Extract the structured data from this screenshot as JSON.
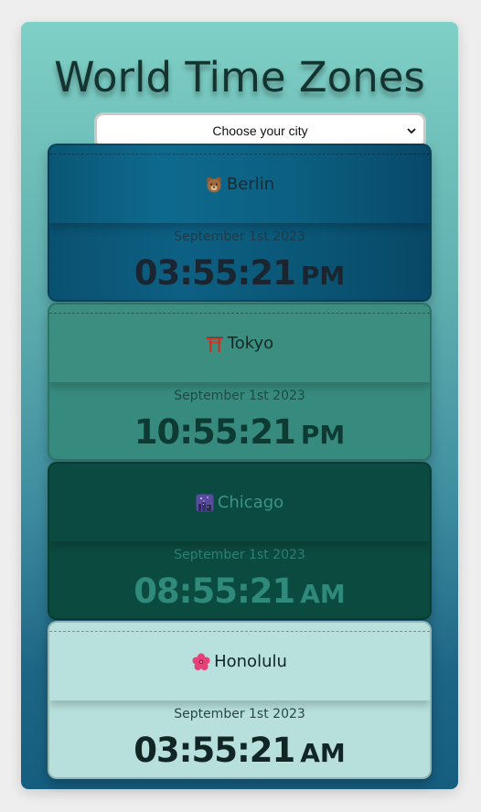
{
  "app": {
    "title": "World Time Zones",
    "select": {
      "value": "Choose your city"
    }
  },
  "cards": [
    {
      "emoji_icon": "bear-icon",
      "city": "Berlin",
      "date": "September 1st 2023",
      "time": "03:55:21",
      "ampm": "PM"
    },
    {
      "emoji_icon": "torii-gate-icon",
      "city": "Tokyo",
      "date": "September 1st 2023",
      "time": "10:55:21",
      "ampm": "PM"
    },
    {
      "emoji_icon": "night-city-icon",
      "city": "Chicago",
      "date": "September 1st 2023",
      "time": "08:55:21",
      "ampm": "AM"
    },
    {
      "emoji_icon": "hibiscus-icon",
      "city": "Honolulu",
      "date": "September 1st 2023",
      "time": "03:55:21",
      "ampm": "AM"
    }
  ],
  "colors": {
    "berlin_card": "#0a5575",
    "tokyo_card": "#378b7e",
    "chicago_card": "#0b4a3f",
    "honolulu_card": "#b7e0dc"
  }
}
